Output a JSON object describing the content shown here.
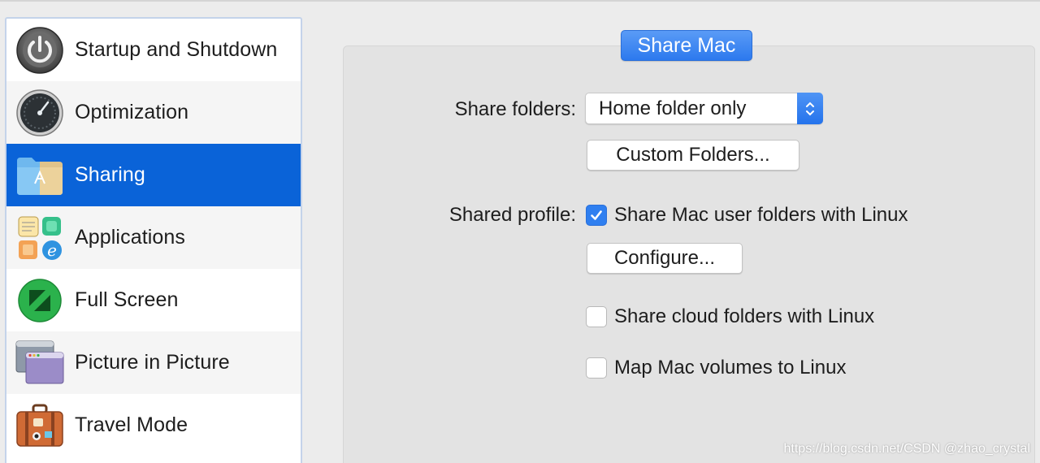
{
  "sidebar": {
    "items": [
      {
        "label": "Startup and Shutdown",
        "icon": "power-icon"
      },
      {
        "label": "Optimization",
        "icon": "speedometer-icon"
      },
      {
        "label": "Sharing",
        "icon": "shared-folder-icon",
        "selected": true
      },
      {
        "label": "Applications",
        "icon": "applications-icon"
      },
      {
        "label": "Full Screen",
        "icon": "fullscreen-icon"
      },
      {
        "label": "Picture in Picture",
        "icon": "picture-in-picture-icon"
      },
      {
        "label": "Travel Mode",
        "icon": "suitcase-icon"
      }
    ]
  },
  "main": {
    "tab_label": "Share Mac",
    "share_folders_label": "Share folders:",
    "share_folders_value": "Home folder only",
    "custom_folders_label": "Custom Folders...",
    "shared_profile_label": "Shared profile:",
    "checkboxes": [
      {
        "label": "Share Mac user folders with Linux",
        "checked": true
      },
      {
        "label": "Share cloud folders with Linux",
        "checked": false
      },
      {
        "label": "Map Mac volumes to Linux",
        "checked": false
      }
    ],
    "configure_label": "Configure..."
  },
  "watermark": "https://blog.csdn.net/CSDN @zhao_crystal",
  "colors": {
    "accent": "#0a63d8",
    "button_blue": "#2c79ee",
    "panel": "#e3e3e3",
    "background": "#ececec"
  }
}
